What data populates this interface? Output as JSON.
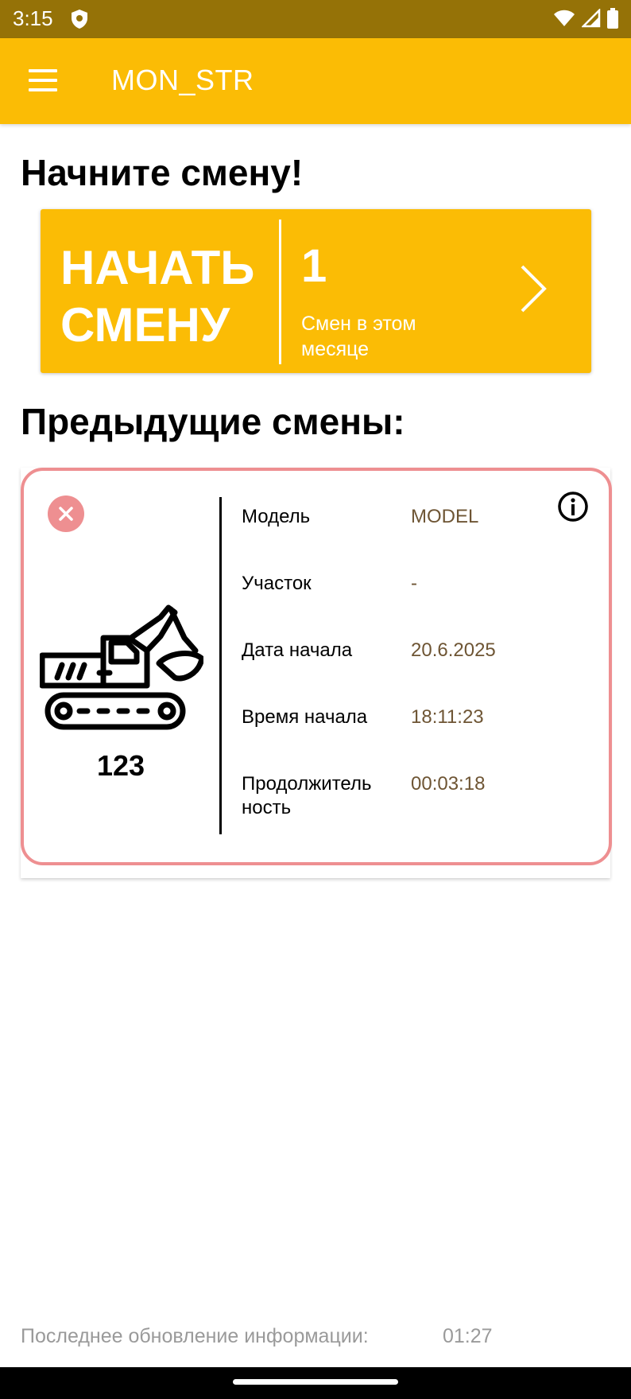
{
  "status_bar": {
    "time": "3:15",
    "icons": [
      "shield-icon",
      "wifi-icon",
      "signal-icon",
      "battery-icon"
    ]
  },
  "app_bar": {
    "title": "MON_STR",
    "menu_icon": "hamburger-menu-icon"
  },
  "start_section": {
    "heading": "Начните смену!",
    "button_label_line1": "НАЧАТЬ",
    "button_label_line2": "СМЕНУ",
    "shift_count": "1",
    "shift_count_caption": "Смен в этом месяце"
  },
  "previous_section": {
    "heading": "Предыдущие смены:",
    "shifts": [
      {
        "machine_number": "123",
        "fields": [
          {
            "label": "Модель",
            "value": "MODEL"
          },
          {
            "label": "Участок",
            "value": "-"
          },
          {
            "label": "Дата начала",
            "value": "20.6.2025"
          },
          {
            "label": "Время начала",
            "value": "18:11:23"
          },
          {
            "label": "Продолжитель ность",
            "value": "00:03:18"
          }
        ]
      }
    ]
  },
  "footer": {
    "label": "Последнее обновление информации:",
    "value": "01:27"
  },
  "colors": {
    "status_bar": "#957207",
    "accent": "#fbbc05",
    "card_border": "#ee8f91",
    "value_text": "#6e5534",
    "muted_text": "#9a9a9a"
  }
}
